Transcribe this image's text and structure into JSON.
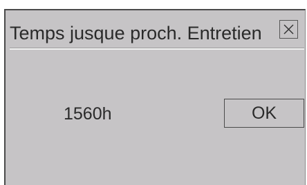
{
  "dialog": {
    "title": "Temps jusque proch. Entretien",
    "close_icon": "close-icon",
    "value": "1560h",
    "ok_label": "OK"
  },
  "colors": {
    "dialog_background": "#c6c4c6",
    "text": "#2a2a2a",
    "border": "#4a4a4a",
    "page_background": "#ffffff"
  }
}
